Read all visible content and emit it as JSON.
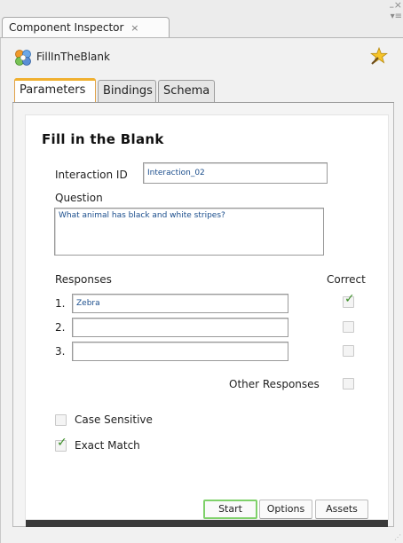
{
  "panel": {
    "tab_label": "Component Inspector",
    "tab_close": "×",
    "component_name": "FillInTheBlank"
  },
  "subtabs": {
    "parameters": "Parameters",
    "bindings": "Bindings",
    "schema": "Schema",
    "active": "parameters"
  },
  "form": {
    "title": "Fill in the Blank",
    "interaction_id_label": "Interaction ID",
    "interaction_id_value": "Interaction_02",
    "question_label": "Question",
    "question_value": "What animal has black and white stripes?",
    "responses_label": "Responses",
    "correct_label": "Correct",
    "responses": [
      {
        "number": "1.",
        "value": "Zebra",
        "correct": true
      },
      {
        "number": "2.",
        "value": "",
        "correct": false
      },
      {
        "number": "3.",
        "value": "",
        "correct": false
      }
    ],
    "other_responses_label": "Other Responses",
    "other_responses_checked": false,
    "case_sensitive_label": "Case Sensitive",
    "case_sensitive_checked": false,
    "exact_match_label": "Exact Match",
    "exact_match_checked": true
  },
  "buttons": {
    "start": "Start",
    "options": "Options",
    "assets": "Assets",
    "active": "start"
  },
  "colors": {
    "active_tab_accent": "#f0b030",
    "active_button_border": "#7fd16a",
    "check_color": "#3d8f2a",
    "field_text": "#1a4d8c"
  }
}
